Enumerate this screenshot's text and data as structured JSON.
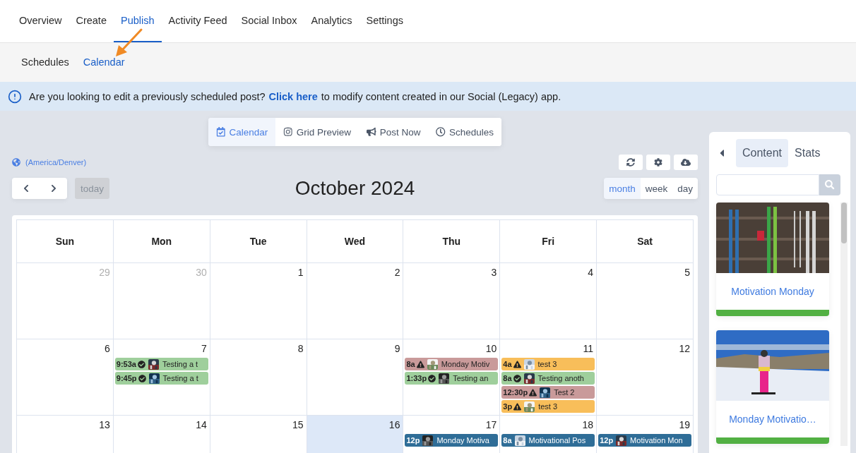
{
  "top_nav": [
    {
      "label": "Overview",
      "selected": false
    },
    {
      "label": "Create",
      "selected": false
    },
    {
      "label": "Publish",
      "selected": true
    },
    {
      "label": "Activity Feed",
      "selected": false
    },
    {
      "label": "Social Inbox",
      "selected": false
    },
    {
      "label": "Analytics",
      "selected": false
    },
    {
      "label": "Settings",
      "selected": false
    }
  ],
  "sub_nav": [
    {
      "label": "Schedules",
      "selected": false
    },
    {
      "label": "Calendar",
      "selected": true
    }
  ],
  "banner": {
    "before": "Are you looking to edit a previously scheduled post?",
    "link": "Click here",
    "after": "to modify content created in our Social (Legacy) app."
  },
  "view_tabs": [
    {
      "kind": "calendar",
      "label": "Calendar",
      "selected": true
    },
    {
      "kind": "grid",
      "label": "Grid Preview",
      "selected": false
    },
    {
      "kind": "megaphone",
      "label": "Post Now",
      "selected": false
    },
    {
      "kind": "clock",
      "label": "Schedules",
      "selected": false
    }
  ],
  "calendar": {
    "timezone": "(America/Denver)",
    "title": "October 2024",
    "today_button": "today",
    "views": [
      {
        "label": "month",
        "selected": true
      },
      {
        "label": "week",
        "selected": false
      },
      {
        "label": "day",
        "selected": false
      }
    ],
    "weekdays": [
      "Sun",
      "Mon",
      "Tue",
      "Wed",
      "Thu",
      "Fri",
      "Sat"
    ],
    "weeks": [
      [
        {
          "day": "29",
          "other_month": true,
          "today": false
        },
        {
          "day": "30",
          "other_month": true,
          "today": false
        },
        {
          "day": "1",
          "other_month": false,
          "today": false
        },
        {
          "day": "2",
          "other_month": false,
          "today": false
        },
        {
          "day": "3",
          "other_month": false,
          "today": false
        },
        {
          "day": "4",
          "other_month": false,
          "today": false
        },
        {
          "day": "5",
          "other_month": false,
          "today": false
        }
      ],
      [
        {
          "day": "6",
          "other_month": false,
          "today": false
        },
        {
          "day": "7",
          "other_month": false,
          "today": false,
          "events": [
            {
              "time": "9:53a",
              "kind": "published",
              "color": "#9fcf9c",
              "title": "Testing a t"
            },
            {
              "time": "9:45p",
              "kind": "published",
              "color": "#9fcf9c",
              "title": "Testing a t"
            }
          ]
        },
        {
          "day": "8",
          "other_month": false,
          "today": false
        },
        {
          "day": "9",
          "other_month": false,
          "today": false
        },
        {
          "day": "10",
          "other_month": false,
          "today": false,
          "events": [
            {
              "time": "8a",
              "kind": "failed",
              "color": "#c99a9a",
              "title": "Monday Motiv"
            },
            {
              "time": "1:33p",
              "kind": "published",
              "color": "#9fcf9c",
              "title": "Testing an"
            }
          ]
        },
        {
          "day": "11",
          "other_month": false,
          "today": false,
          "events": [
            {
              "time": "4a",
              "kind": "failed",
              "color": "#f8be5a",
              "title": "test 3"
            },
            {
              "time": "8a",
              "kind": "published",
              "color": "#9fcf9c",
              "title": "Testing anoth"
            },
            {
              "time": "12:30p",
              "kind": "failed",
              "color": "#c99a9a",
              "title": "Test 2"
            },
            {
              "time": "3p",
              "kind": "failed",
              "color": "#f8be5a",
              "title": "test 3"
            }
          ]
        },
        {
          "day": "12",
          "other_month": false,
          "today": false
        }
      ],
      [
        {
          "day": "13",
          "other_month": false,
          "today": false
        },
        {
          "day": "14",
          "other_month": false,
          "today": false
        },
        {
          "day": "15",
          "other_month": false,
          "today": false
        },
        {
          "day": "16",
          "other_month": false,
          "today": true
        },
        {
          "day": "17",
          "other_month": false,
          "today": false,
          "events": [
            {
              "time": "12p",
              "kind": "scheduled",
              "color": "#2f6d97",
              "title": "Monday Motiva"
            }
          ]
        },
        {
          "day": "18",
          "other_month": false,
          "today": false,
          "events": [
            {
              "time": "8a",
              "kind": "scheduled",
              "color": "#2f6d97",
              "title": "Motivational Pos"
            }
          ]
        },
        {
          "day": "19",
          "other_month": false,
          "today": false,
          "events": [
            {
              "time": "12p",
              "kind": "scheduled",
              "color": "#2f6d97",
              "title": "Motivation Mon"
            }
          ]
        }
      ]
    ]
  },
  "side_panel": {
    "tabs": [
      {
        "label": "Content",
        "selected": true
      },
      {
        "label": "Stats",
        "selected": false
      }
    ],
    "cards": [
      {
        "kind": "picture",
        "title": "Motivation Monday"
      },
      {
        "kind": "picture",
        "title": "Monday Motivatio…"
      }
    ]
  }
}
